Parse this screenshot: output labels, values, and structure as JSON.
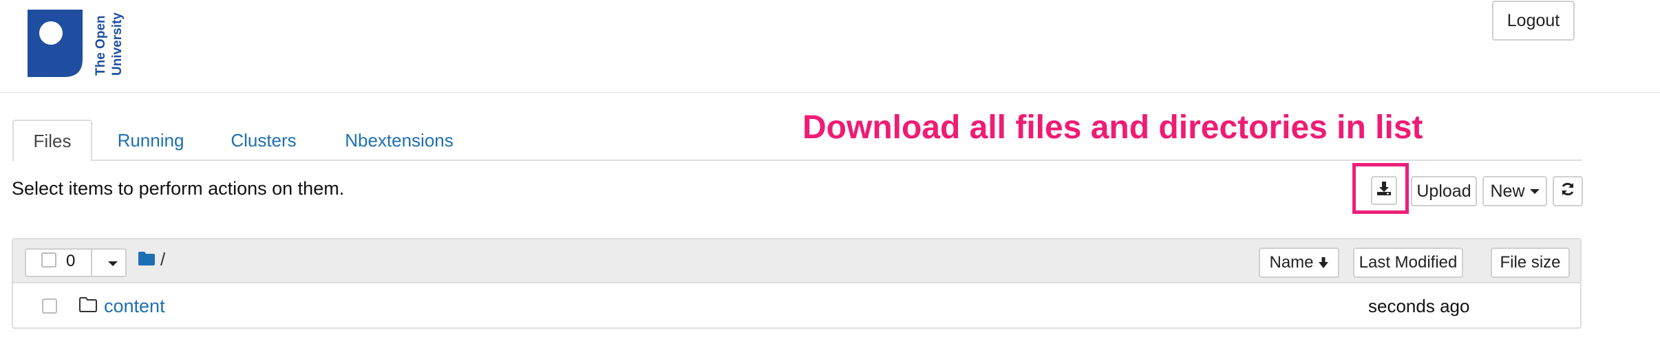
{
  "header": {
    "logo_text": "The Open University",
    "logout_label": "Logout"
  },
  "tabs": [
    {
      "label": "Files",
      "active": true
    },
    {
      "label": "Running",
      "active": false
    },
    {
      "label": "Clusters",
      "active": false
    },
    {
      "label": "Nbextensions",
      "active": false
    }
  ],
  "annotation": {
    "text": "Download all files and directories in list",
    "color": "#ef1b74"
  },
  "toolbar": {
    "hint": "Select items to perform actions on them.",
    "download_icon": "download-icon",
    "upload_label": "Upload",
    "new_label": "New",
    "refresh_icon": "refresh-icon"
  },
  "list": {
    "selected_count": "0",
    "breadcrumb": "/",
    "sort_name_label": "Name",
    "sort_modified_label": "Last Modified",
    "sort_size_label": "File size",
    "rows": [
      {
        "name": "content",
        "type": "folder",
        "modified": "seconds ago",
        "size": ""
      }
    ]
  },
  "colors": {
    "link": "#1d6eb3",
    "brand_blue": "#1f4ea0",
    "highlight": "#ec1f78",
    "header_bg": "#ececec"
  }
}
